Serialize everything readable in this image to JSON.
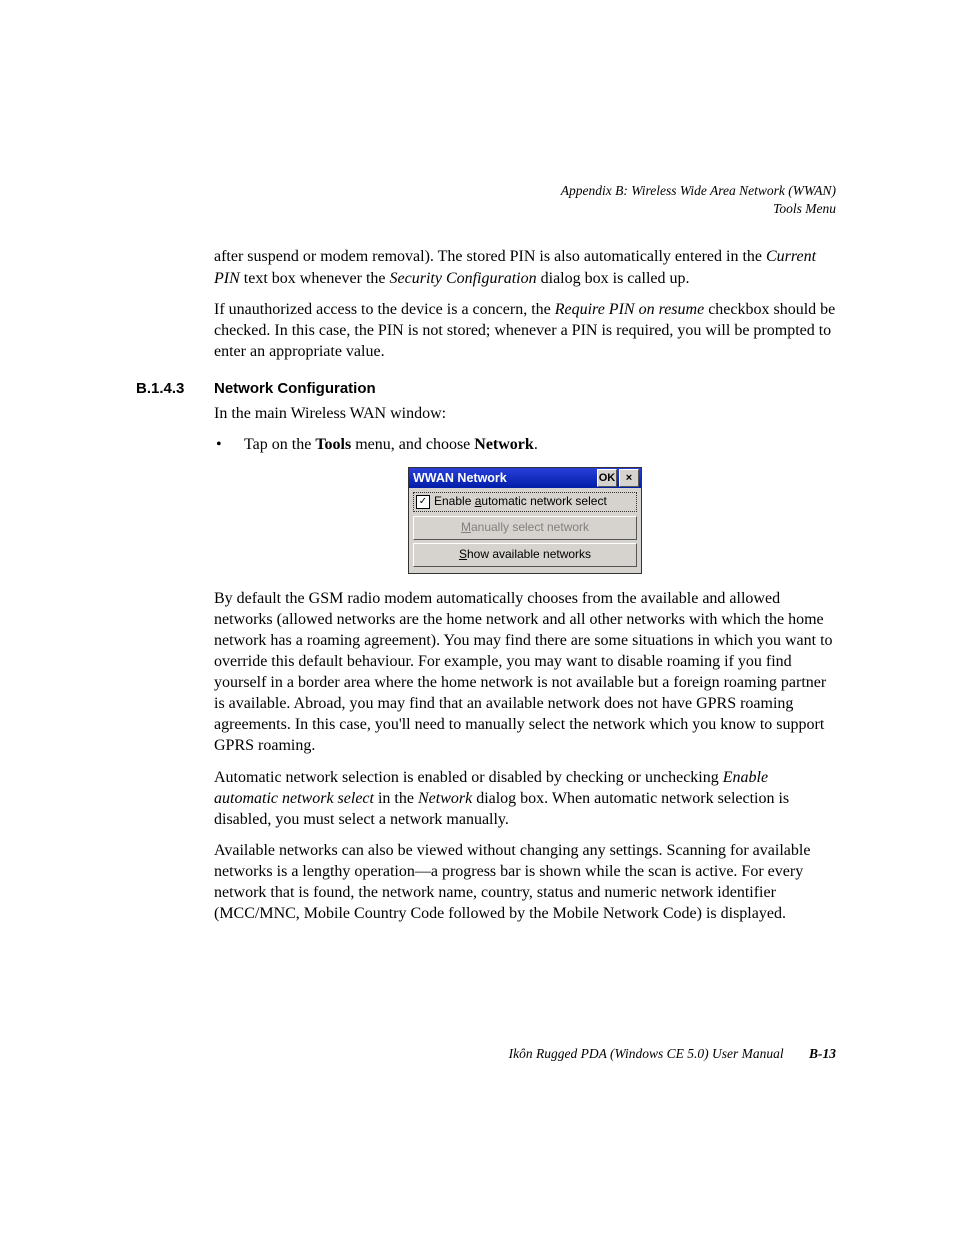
{
  "header": {
    "line1": "Appendix B: Wireless Wide Area Network (WWAN)",
    "line2": "Tools Menu"
  },
  "para1": {
    "t1": "after suspend or modem removal). The stored PIN is also automatically entered in the ",
    "i1": "Current PIN",
    "t2": " text box whenever the ",
    "i2": "Security Configuration",
    "t3": " dialog box is called up."
  },
  "para2": {
    "t1": "If unauthorized access to the device is a concern, the ",
    "i1": "Require PIN on resume",
    "t2": " checkbox should be checked. In this case, the PIN is not stored; whenever a PIN is required, you will be prompted to enter an appropriate value."
  },
  "section": {
    "num": "B.1.4.3",
    "title": "Network Configuration"
  },
  "para3": "In the main Wireless WAN window:",
  "bullet": {
    "t1": "Tap on the ",
    "b1": "Tools",
    "t2": " menu, and choose ",
    "b2": "Network",
    "t3": "."
  },
  "wwan": {
    "title": "WWAN Network",
    "ok": "OK",
    "close": "×",
    "check_glyph": "✓",
    "checkbox_label_pre": "Enable ",
    "checkbox_label_ul": "a",
    "checkbox_label_post": "utomatic network select",
    "btn1_ul": "M",
    "btn1_post": "anually select network",
    "btn2_ul": "S",
    "btn2_post": "how available networks"
  },
  "para4": "By default the GSM radio modem automatically chooses from the available and allowed networks (allowed networks are the home network and all other networks with which the home network has a roaming agreement). You may find there are some situations in which you want to override this default behaviour. For example, you may want to disable roaming if you find yourself in a border area where the home network is not available but a foreign roaming partner is available. Abroad, you may find that an available network does not have GPRS roaming agreements. In this case, you'll need to manually select the network which you know to support GPRS roaming.",
  "para5": {
    "t1": "Automatic network selection is enabled or disabled by checking or unchecking ",
    "i1": "Enable automatic network select",
    "t2": " in the ",
    "i2": "Network",
    "t3": " dialog box. When automatic network selection is disabled, you must select a network manually."
  },
  "para6": "Available networks can also be viewed without changing any settings. Scanning for available networks is a lengthy operation—a progress bar is shown while the scan is active. For every network that is found, the network name, country, status and numeric network identifier (MCC/MNC, Mobile Country Code followed by the Mobile Network Code) is displayed.",
  "footer": {
    "text": "Ikôn Rugged PDA (Windows CE 5.0) User Manual",
    "page": "B-13"
  }
}
